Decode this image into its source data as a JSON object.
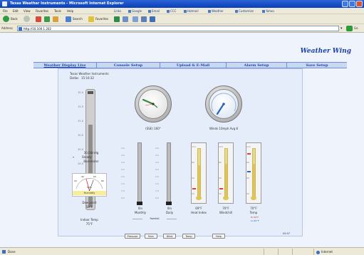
{
  "window": {
    "title": "Texas Weather Instruments - Microsoft Internet Explorer"
  },
  "menubar": {
    "items": [
      "File",
      "Edit",
      "View",
      "Favorites",
      "Tools",
      "Help"
    ],
    "links": [
      "Links",
      "Google",
      "Email",
      "CCC",
      "Hotmail",
      "Weather",
      "Customize",
      "Yahoo"
    ]
  },
  "toolbar": {
    "back": "Back",
    "search": "Search",
    "favorites": "Favorites"
  },
  "address": {
    "label": "Address",
    "url": "http://10.100.1.202",
    "go": "Go"
  },
  "header": {
    "site_title": "Weather Wing"
  },
  "nav": {
    "tabs": [
      "Weather Display Live",
      "Console Setup",
      "Upload & E-Mail",
      "Alarm Setup",
      "Save Setup"
    ],
    "active_index": 0
  },
  "panel": {
    "station_name": "Texas Weather Instruments",
    "station_city": "Dallas",
    "station_time": "15:16:32",
    "baro_scale": [
      "32.0",
      "31.5",
      "31.0",
      "30.5",
      "30.0",
      "29.5",
      "29.0",
      "28.5"
    ],
    "baro_reading": "30.08inHg",
    "baro_trend": "Steady",
    "baro_label": "Barometer",
    "hygro_ticks": [
      "20",
      "40",
      "60",
      "80"
    ],
    "hygro_percent": "50%",
    "hygro_label": "Humidity",
    "dew_point_label": "Dew point",
    "dew_point_value": "50°F",
    "indoor_temp_label": "Indoor Temp",
    "indoor_temp_value": "75°F",
    "wind_dir_label": "(SSE) 160°",
    "wind_speed_label": "Winds 10mph Avg 8",
    "rain_ticks": [
      "4.0",
      "3.5",
      "3.0",
      "2.5",
      "2.0",
      "1.5",
      "1.0",
      "0.5"
    ],
    "rain_monthly_value": "0in",
    "rain_monthly_label": "Monthly",
    "rain_daily_value": "0in",
    "rain_daily_label": "Daily",
    "rainfall_label": "Rainfall",
    "thermo_ticks": [
      "110",
      "100",
      "90",
      "80",
      "70",
      "60",
      "50",
      "40",
      "30",
      "20",
      "10"
    ],
    "heat_index_value": "69°F",
    "heat_index_label": "Heat Index",
    "windchill_value": "70°F",
    "windchill_label": "Windchill",
    "temp_value": "70°F",
    "temp_label": "Temp",
    "legend_hi": "Hi 80°F",
    "legend_lo": "Lo 60°F",
    "page_time": "05:07",
    "buttons": [
      "Pressure",
      "Rain",
      "Wind",
      "Temp",
      "Help"
    ]
  },
  "values": {
    "wind_direction_deg": 160,
    "wind_speed_mph": 10,
    "barometer_fraction": 0.68,
    "rain_monthly_in": 0,
    "rain_daily_in": 0,
    "heat_index_f": 69,
    "windchill_f": 70,
    "temp_f": 70
  },
  "status": {
    "text": "Done",
    "zone": "Internet"
  },
  "colors": {
    "title_bar": "#0a3fb5",
    "brand": "#1c3fa8",
    "panel_bg": "#e4edf9",
    "needle_red": "#e23d3d",
    "needle_blue": "#2f63b3",
    "green_pointer": "#2e8b3a",
    "thermo_fill": "#e9d98a"
  },
  "icons": [
    "ie-logo-icon",
    "back-icon",
    "forward-icon",
    "stop-icon",
    "refresh-icon",
    "home-icon",
    "search-icon",
    "favorites-icon",
    "media-icon",
    "history-icon",
    "mail-icon",
    "print-icon",
    "page-icon",
    "go-icon",
    "globe-icon"
  ]
}
